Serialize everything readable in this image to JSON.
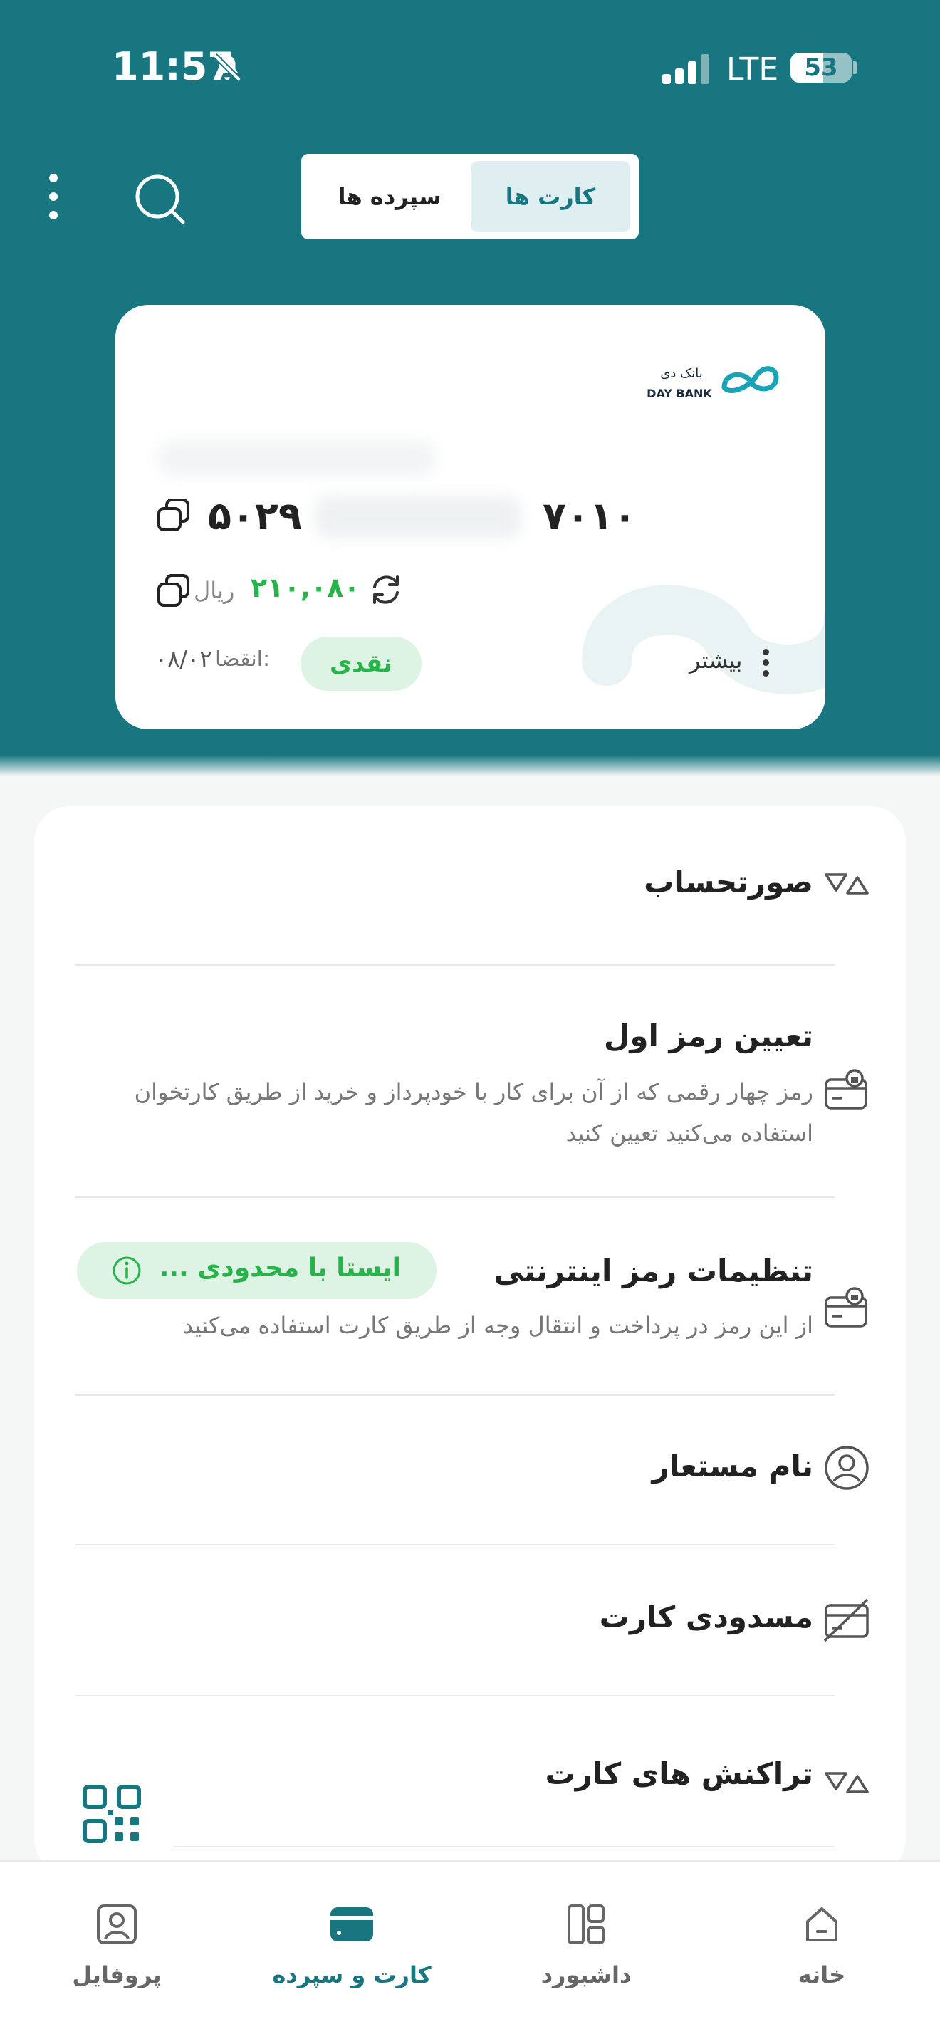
{
  "status_bar": {
    "time": "11:57",
    "network": "LTE",
    "battery": "53",
    "battery_level": 0.53
  },
  "top_bar": {
    "tabs": [
      {
        "label": "کارت ها",
        "active": true
      },
      {
        "label": "سپرده ها",
        "active": false
      }
    ],
    "search_icon": "search-icon",
    "menu_icon": "more-vertical-icon"
  },
  "card": {
    "bank_logo_text": "بانک دی",
    "bank_logo_latin": "DAY BANK",
    "number_end": "۷۰۱۰",
    "number_start": "۵۰۲۹",
    "balance": "۲۱۰,۰۸۰",
    "currency": "ریال",
    "more_label": "بیشتر",
    "type_badge": "نقدی",
    "expiry_label": "انقضا:",
    "expiry_value": "۰۸/۰۲"
  },
  "menu": [
    {
      "title": "صورتحساب",
      "icon": "statement-icon"
    },
    {
      "title": "تعیین رمز اول",
      "description_line1": "رمز چهار رقمی که از آن برای کار با خودپرداز و خرید از طریق کارتخوان",
      "description_line2": "استفاده می‌کنید تعیین کنید",
      "icon": "card-lock-icon"
    },
    {
      "title": "تنظیمات رمز اینترنتی",
      "description_line1": "از این رمز در پرداخت و انتقال وجه از طریق کارت استفاده می‌کنید",
      "status": "ایستا با محدودی ...",
      "icon": "card-lock-icon"
    },
    {
      "title": "نام مستعار",
      "icon": "user-circle-icon"
    },
    {
      "title": "مسدودی کارت",
      "icon": "card-block-icon"
    },
    {
      "title": "تراکنش های کارت",
      "icon": "transactions-icon"
    }
  ],
  "bottom_nav": [
    {
      "label": "خانه",
      "icon": "home-icon",
      "active": false
    },
    {
      "label": "داشبورد",
      "icon": "dashboard-icon",
      "active": false
    },
    {
      "label": "کارت و سپرده",
      "icon": "card-icon",
      "active": true
    },
    {
      "label": "پروفایل",
      "icon": "profile-icon",
      "active": false
    }
  ],
  "colors": {
    "primary": "#17767f",
    "success": "#27b24a",
    "success_bg": "#ddf3e3"
  }
}
